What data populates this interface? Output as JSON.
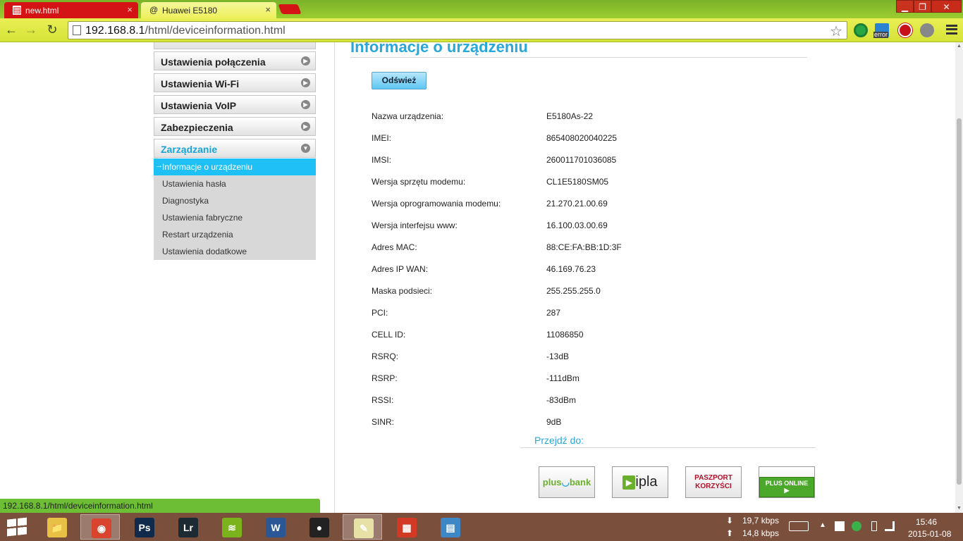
{
  "browser": {
    "tabs": [
      {
        "label": "new.html",
        "close": "×"
      },
      {
        "label": "Huawei E5180",
        "close": "×"
      }
    ],
    "window_buttons": {
      "minimize": "▁",
      "maximize": "❐",
      "close": "✕"
    },
    "url_host": "192.168.8.1",
    "url_path": "/html/deviceinformation.html",
    "status_url": "192.168.8.1/html/deviceinformation.html",
    "extensions": {
      "error_badge": "error"
    }
  },
  "sidebar": {
    "items": [
      {
        "label": "Ustawienia połączenia"
      },
      {
        "label": "Ustawienia Wi-Fi"
      },
      {
        "label": "Ustawienia VoIP"
      },
      {
        "label": "Zabezpieczenia"
      },
      {
        "label": "Zarządzanie"
      }
    ],
    "submenu": [
      {
        "label": "Informacje o urządzeniu"
      },
      {
        "label": "Ustawienia hasła"
      },
      {
        "label": "Diagnostyka"
      },
      {
        "label": "Ustawienia fabryczne"
      },
      {
        "label": "Restart urządzenia"
      },
      {
        "label": "Ustawienia dodatkowe"
      }
    ]
  },
  "main": {
    "title": "Informacje o urządzeniu",
    "refresh_label": "Odśwież",
    "info": [
      {
        "label": "Nazwa urządzenia:",
        "value": "E5180As-22"
      },
      {
        "label": "IMEI:",
        "value": "865408020040225"
      },
      {
        "label": "IMSI:",
        "value": "260011701036085"
      },
      {
        "label": "Wersja sprzętu modemu:",
        "value": "CL1E5180SM05"
      },
      {
        "label": "Wersja oprogramowania modemu:",
        "value": "21.270.21.00.69"
      },
      {
        "label": "Wersja interfejsu www:",
        "value": "16.100.03.00.69"
      },
      {
        "label": "Adres MAC:",
        "value": "88:CE:FA:BB:1D:3F"
      },
      {
        "label": "Adres IP WAN:",
        "value": "46.169.76.23"
      },
      {
        "label": "Maska podsieci:",
        "value": "255.255.255.0"
      },
      {
        "label": "PCI:",
        "value": "287"
      },
      {
        "label": "CELL ID:",
        "value": "11086850"
      },
      {
        "label": "RSRQ:",
        "value": "-13dB"
      },
      {
        "label": "RSRP:",
        "value": "-111dBm"
      },
      {
        "label": "RSSI:",
        "value": "-83dBm"
      },
      {
        "label": "SINR:",
        "value": "9dB"
      }
    ],
    "goto_label": "Przejdź do:",
    "promos": [
      {
        "name": "plus bank",
        "text_a": "plus",
        "text_b": "bank"
      },
      {
        "name": "ipla",
        "text": "ipla"
      },
      {
        "name": "paszport korzysci",
        "line1": "PASZPORT",
        "line2": "KORZYŚCI"
      },
      {
        "name": "plus online",
        "text": "PLUS ONLINE ▶"
      }
    ]
  },
  "taskbar": {
    "apps": [
      {
        "name": "file-explorer",
        "glyph": "📁",
        "color": "#e9c046"
      },
      {
        "name": "chrome",
        "glyph": "◉",
        "color": "#d9442f"
      },
      {
        "name": "photoshop",
        "glyph": "Ps",
        "color": "#0f2a4a"
      },
      {
        "name": "lightroom",
        "glyph": "Lr",
        "color": "#1b2a33"
      },
      {
        "name": "spotify",
        "glyph": "≋",
        "color": "#7bb31c"
      },
      {
        "name": "word",
        "glyph": "W",
        "color": "#2b5797"
      },
      {
        "name": "media-player",
        "glyph": "●",
        "color": "#222"
      },
      {
        "name": "notepad",
        "glyph": "✎",
        "color": "#e7e1a6"
      },
      {
        "name": "windows-app",
        "glyph": "▦",
        "color": "#d23a25"
      },
      {
        "name": "control-panel",
        "glyph": "▤",
        "color": "#3d87c7"
      }
    ],
    "download_speed": "19,7 kbps",
    "upload_speed": "14,8 kbps",
    "time": "15:46",
    "date": "2015-01-08"
  }
}
